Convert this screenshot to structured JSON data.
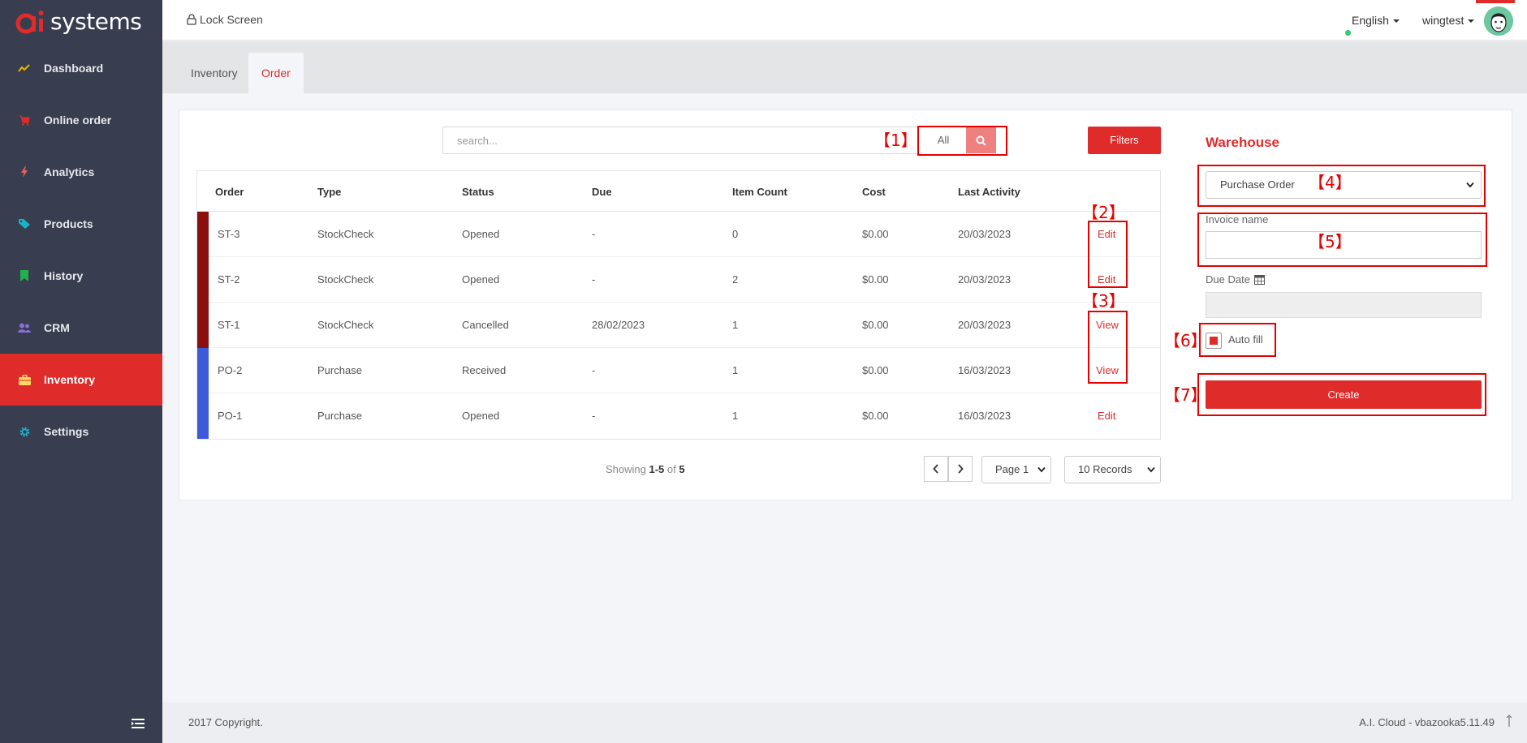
{
  "brand": {
    "logo_text": "systems",
    "accent": "#e02b2b"
  },
  "sidebar": {
    "items": [
      {
        "label": "Dashboard",
        "icon": "chart-line-icon",
        "color": "#e6b800"
      },
      {
        "label": "Online order",
        "icon": "cart-icon",
        "color": "#e02b2b"
      },
      {
        "label": "Analytics",
        "icon": "bolt-icon",
        "color": "#e86060"
      },
      {
        "label": "Products",
        "icon": "tag-icon",
        "color": "#1ab3c8"
      },
      {
        "label": "History",
        "icon": "bookmark-icon",
        "color": "#22b14c"
      },
      {
        "label": "CRM",
        "icon": "users-icon",
        "color": "#8a6fd8"
      },
      {
        "label": "Inventory",
        "icon": "briefcase-icon",
        "color": "#ffffff"
      },
      {
        "label": "Settings",
        "icon": "gear-icon",
        "color": "#1ab3c8"
      }
    ]
  },
  "header": {
    "lock_screen": "Lock Screen",
    "language": "English",
    "username": "wingtest"
  },
  "tabs": [
    {
      "label": "Inventory"
    },
    {
      "label": "Order"
    }
  ],
  "search": {
    "placeholder": "search...",
    "scope": "All",
    "filters_label": "Filters"
  },
  "table": {
    "headers": [
      "Order",
      "Type",
      "Status",
      "Due",
      "Item Count",
      "Cost",
      "Last Activity"
    ],
    "rows": [
      {
        "order": "ST-3",
        "type": "StockCheck",
        "status": "Opened",
        "due": "-",
        "count": "0",
        "cost": "$0.00",
        "activity": "20/03/2023",
        "action": "Edit",
        "bar_color": "#8b0f0f"
      },
      {
        "order": "ST-2",
        "type": "StockCheck",
        "status": "Opened",
        "due": "-",
        "count": "2",
        "cost": "$0.00",
        "activity": "20/03/2023",
        "action": "Edit",
        "bar_color": "#8b0f0f"
      },
      {
        "order": "ST-1",
        "type": "StockCheck",
        "status": "Cancelled",
        "due": "28/02/2023",
        "count": "1",
        "cost": "$0.00",
        "activity": "20/03/2023",
        "action": "View",
        "bar_color": "#8b0f0f"
      },
      {
        "order": "PO-2",
        "type": "Purchase",
        "status": "Received",
        "due": "-",
        "count": "1",
        "cost": "$0.00",
        "activity": "16/03/2023",
        "action": "View",
        "bar_color": "#3d5bd9"
      },
      {
        "order": "PO-1",
        "type": "Purchase",
        "status": "Opened",
        "due": "-",
        "count": "1",
        "cost": "$0.00",
        "activity": "16/03/2023",
        "action": "Edit",
        "bar_color": "#3d5bd9"
      }
    ]
  },
  "pagination": {
    "showing_prefix": "Showing",
    "range": "1-5",
    "of": "of",
    "total": "5",
    "page": "Page 1",
    "records": "10 Records"
  },
  "panel": {
    "title": "Warehouse",
    "order_type": "Purchase Order",
    "invoice_label": "Invoice name",
    "invoice_value": "",
    "due_date_label": "Due Date",
    "autofill_label": "Auto fill",
    "autofill_checked": true,
    "create_label": "Create"
  },
  "annotations": [
    "【1】",
    "【2】",
    "【3】",
    "【4】",
    "【5】",
    "【6】",
    "【7】"
  ],
  "footer": {
    "copyright": "2017 Copyright.",
    "version": "A.I. Cloud - vbazooka5.11.49"
  }
}
